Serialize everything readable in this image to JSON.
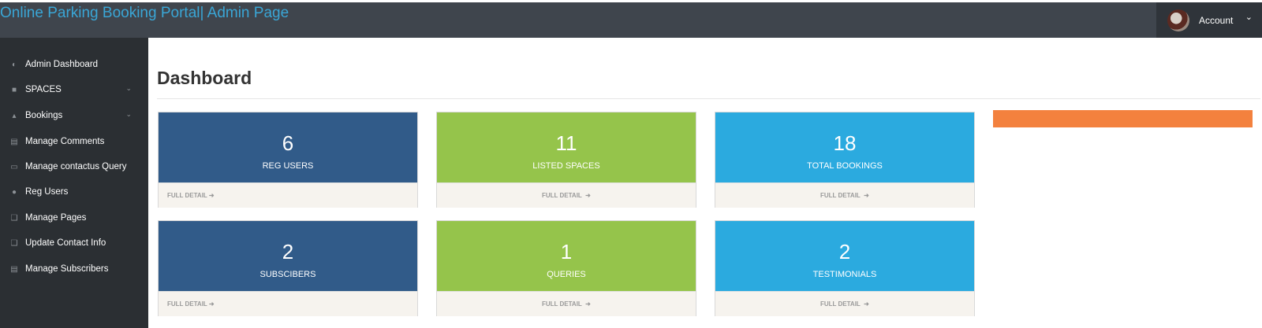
{
  "header": {
    "brand": "Online Parking Booking Portal| Admin Page",
    "account_label": "Account",
    "caret_icon": "chevron-down-icon"
  },
  "sidebar": {
    "items": [
      {
        "label": "Admin Dashboard",
        "icon": "dashboard-icon",
        "has_chevron": false
      },
      {
        "label": "SPACES",
        "icon": "car-icon",
        "has_chevron": true
      },
      {
        "label": "Bookings",
        "icon": "sitemap-icon",
        "has_chevron": true
      },
      {
        "label": "Manage Comments",
        "icon": "table-icon",
        "has_chevron": false
      },
      {
        "label": "Manage contactus Query",
        "icon": "desktop-icon",
        "has_chevron": false
      },
      {
        "label": "Reg Users",
        "icon": "users-icon",
        "has_chevron": false
      },
      {
        "label": "Manage Pages",
        "icon": "files-icon",
        "has_chevron": false
      },
      {
        "label": "Update Contact Info",
        "icon": "files-icon",
        "has_chevron": false
      },
      {
        "label": "Manage Subscribers",
        "icon": "table-icon",
        "has_chevron": false
      }
    ]
  },
  "main": {
    "title": "Dashboard",
    "cards": [
      {
        "value": "6",
        "label": "REG USERS",
        "footer": "FULL DETAIL",
        "color": "#315b89"
      },
      {
        "value": "11",
        "label": "LISTED SPACES",
        "footer": "FULL DETAIL",
        "color": "#95c44b"
      },
      {
        "value": "18",
        "label": "TOTAL BOOKINGS",
        "footer": "FULL DETAIL",
        "color": "#2baadf"
      },
      {
        "value": "2",
        "label": "SUBSCIBERS",
        "footer": "FULL DETAIL",
        "color": "#315b89"
      },
      {
        "value": "1",
        "label": "QUERIES",
        "footer": "FULL DETAIL",
        "color": "#95c44b"
      },
      {
        "value": "2",
        "label": "TESTIMONIALS",
        "footer": "FULL DETAIL",
        "color": "#2baadf"
      }
    ],
    "accent_bar_color": "#f3813e"
  }
}
